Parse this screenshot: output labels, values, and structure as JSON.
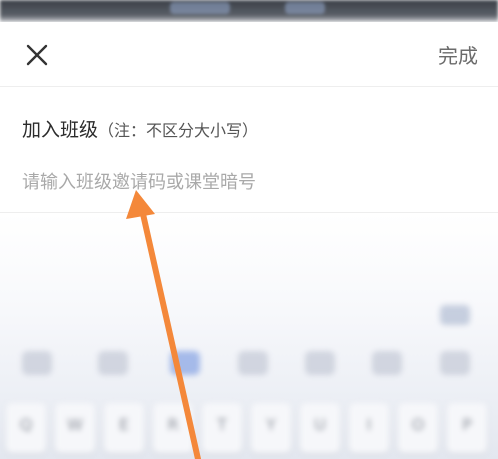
{
  "header": {
    "close_icon": "close-icon",
    "done_label": "完成"
  },
  "join": {
    "title": "加入班级",
    "note": "（注：不区分大小写）",
    "placeholder": "请输入班级邀请码或课堂暗号",
    "value": ""
  },
  "annotation": {
    "arrow_color": "#f4883a"
  }
}
